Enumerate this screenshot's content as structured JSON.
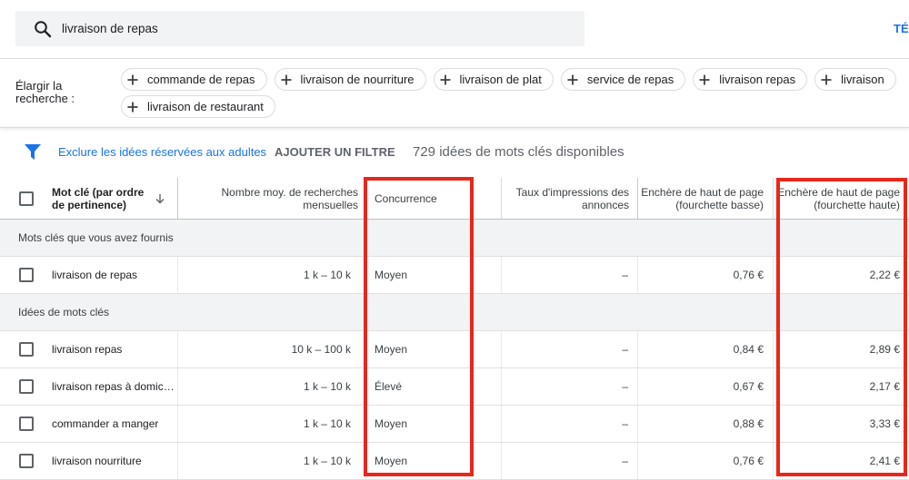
{
  "search": {
    "query": "livraison de repas",
    "icon": "search-icon"
  },
  "top_action": {
    "label": "TÉ"
  },
  "broaden": {
    "label": "Élargir la recherche :",
    "chip_icon": "plus-icon",
    "chips": [
      "commande de repas",
      "livraison de nourriture",
      "livraison de plat",
      "service de repas",
      "livraison repas",
      "livraison",
      "livraison de restaurant"
    ]
  },
  "filters": {
    "icon": "filter-icon",
    "exclude_adult": "Exclure les idées réservées aux adultes",
    "add_filter": "AJOUTER UN FILTRE",
    "count": "729 idées de mots clés disponibles"
  },
  "table": {
    "sort_icon": "arrow-down-icon",
    "columns": [
      {
        "label": "Mot clé (par ordre de pertinence)"
      },
      {
        "label": "Nombre moy. de recherches mensuelles"
      },
      {
        "label": "Concurrence"
      },
      {
        "label": "Taux d'impressions des annonces"
      },
      {
        "label": "Enchère de haut de page (fourchette basse)"
      },
      {
        "label": "Enchère de haut de page (fourchette haute)"
      }
    ],
    "groups": [
      {
        "title": "Mots clés que vous avez fournis",
        "rows": [
          {
            "keyword": "livraison de repas",
            "searches": "1 k – 10 k",
            "competition": "Moyen",
            "impression_share": "–",
            "bid_low": "0,76 €",
            "bid_high": "2,22 €"
          }
        ]
      },
      {
        "title": "Idées de mots clés",
        "rows": [
          {
            "keyword": "livraison repas",
            "searches": "10 k – 100 k",
            "competition": "Moyen",
            "impression_share": "–",
            "bid_low": "0,84 €",
            "bid_high": "2,89 €"
          },
          {
            "keyword": "livraison repas à domic…",
            "searches": "1 k – 10 k",
            "competition": "Élevé",
            "impression_share": "–",
            "bid_low": "0,67 €",
            "bid_high": "2,17 €"
          },
          {
            "keyword": "commander a manger",
            "searches": "1 k – 10 k",
            "competition": "Moyen",
            "impression_share": "–",
            "bid_low": "0,88 €",
            "bid_high": "3,33 €"
          },
          {
            "keyword": "livraison nourriture",
            "searches": "1 k – 10 k",
            "competition": "Moyen",
            "impression_share": "–",
            "bid_low": "0,76 €",
            "bid_high": "2,41 €"
          }
        ]
      }
    ]
  },
  "colors": {
    "accent": "#1a73e8",
    "highlight": "#e8271c"
  }
}
